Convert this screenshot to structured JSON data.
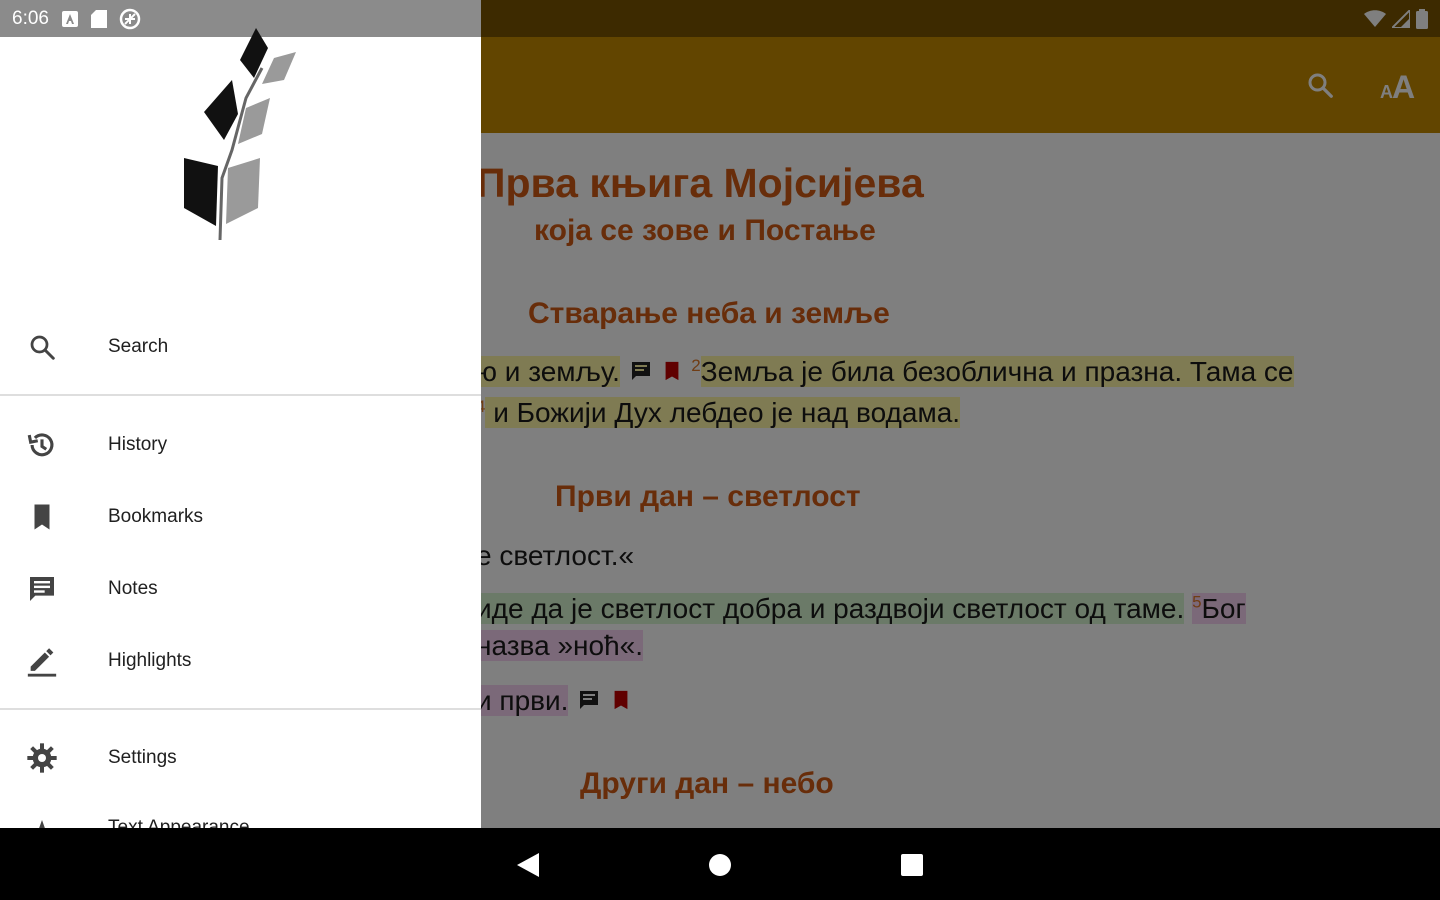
{
  "status_bar": {
    "time": "6:06"
  },
  "reader": {
    "title": "Прва књига Мојсијева",
    "subtitle": "која се зове и Постање",
    "section1_heading": "Стварање неба и земље",
    "line1_a": "ю и земљу.",
    "line1_verse_num": "2",
    "line1_b": "Земља је била безоблична и празна. Тама се",
    "line2_verse_num": "4",
    "line2": " и Божији Дух лебдео је над водама.",
    "section2_heading": "Први дан – светлост",
    "line3": "е светлост.«",
    "line4_a": "иде да је светлост добра и раздвоји светлост од таме.",
    "line4_verse_num": "5",
    "line4_b": "Бог",
    "line5": "назва »ноћ«.",
    "line6": "и први.",
    "section3_heading": "Други дан – небо"
  },
  "drawer": {
    "items": [
      {
        "label": "Search",
        "icon": "search-icon"
      },
      {
        "label": "History",
        "icon": "history-icon"
      },
      {
        "label": "Bookmarks",
        "icon": "bookmark-icon"
      },
      {
        "label": "Notes",
        "icon": "note-icon"
      },
      {
        "label": "Highlights",
        "icon": "highlight-pen-icon"
      },
      {
        "label": "Settings",
        "icon": "gear-icon"
      },
      {
        "label": "Text Appearance",
        "icon": "text-size-icon"
      }
    ]
  },
  "colors": {
    "app_bar": "#c48a00",
    "heading_text": "#d05a14",
    "highlight_yellow": "#fff6a6",
    "highlight_green": "#d6f5d0",
    "highlight_pink": "#f6d2f2",
    "bookmark_red": "#c00000"
  }
}
